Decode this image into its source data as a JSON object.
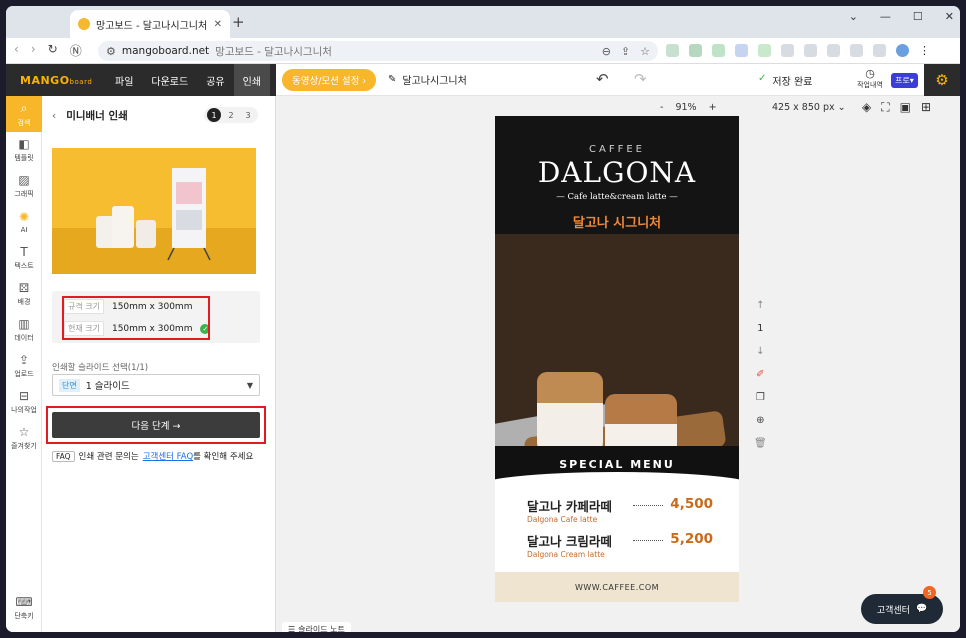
{
  "browser": {
    "tab_title": "망고보드 - 달고나시그니처",
    "url_domain": "mangoboard.net",
    "url_title": "망고보드 - 달고나시그니처"
  },
  "header": {
    "logo": "MANGO",
    "logo_suffix": "board",
    "menu": [
      "파일",
      "다운로드",
      "공유",
      "인쇄"
    ],
    "motion_button": "동영상/모션 설정 ›",
    "doc_name": "달고나시그니처",
    "save_status": "저장 완료",
    "history_label": "작업내역",
    "plan_badge": "프로"
  },
  "rail": {
    "items": [
      "검색",
      "템플릿",
      "그래픽",
      "AI",
      "텍스트",
      "배경",
      "데이터",
      "업로드",
      "나의작업",
      "즐겨찾기"
    ],
    "shortcut": "단축키"
  },
  "panel": {
    "title": "미니배너 인쇄",
    "steps": [
      "1",
      "2",
      "3"
    ],
    "spec_label": "규격 크기",
    "spec_value": "150mm x 300mm",
    "current_label": "현재 크기",
    "current_value": "150mm x 300mm",
    "select_label": "인쇄할 슬라이드 선택(1/1)",
    "select_tag": "단면",
    "select_value": "1 슬라이드",
    "next_button": "다음 단계 →",
    "faq_badge": "FAQ",
    "faq_text_1": "인쇄 관련 문의는",
    "faq_link": "고객센터 FAQ",
    "faq_text_2": "를 확인해 주세요"
  },
  "canvas": {
    "zoom_minus": "-",
    "zoom": "91%",
    "zoom_plus": "+",
    "dims": "425 x 850 px",
    "page_number": "1",
    "slide_note": "슬라이드 노트",
    "support_button": "고객센터",
    "support_badge": "5"
  },
  "artwork": {
    "caffee": "CAFFEE",
    "title": "DALGONA",
    "subtitle": "— Cafe latte&cream latte —",
    "korean_title": "달고나 시그니처",
    "special_menu": "SPECIAL MENU",
    "items": [
      {
        "name": "달고나 카페라떼",
        "english": "Dalgona Cafe latte",
        "price": "4,500"
      },
      {
        "name": "달고나 크림라떼",
        "english": "Dalgona Cream latte",
        "price": "5,200"
      }
    ],
    "website": "WWW.CAFFEE.COM"
  }
}
